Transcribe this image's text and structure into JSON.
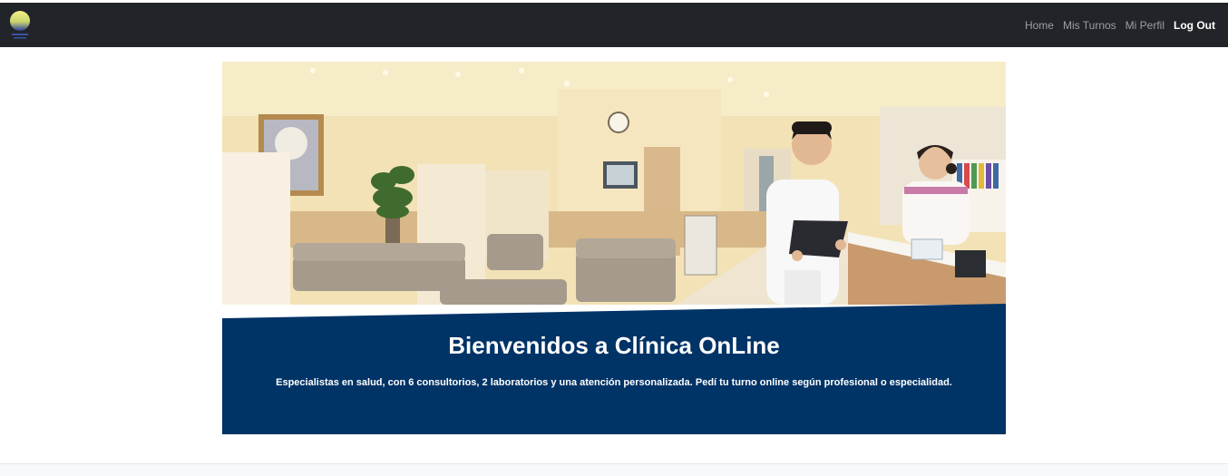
{
  "navbar": {
    "logo_icon": "clinic-logo-sphere",
    "links": [
      {
        "label": "Home"
      },
      {
        "label": "Mis Turnos"
      },
      {
        "label": "Mi Perfil"
      },
      {
        "label": "Log Out"
      }
    ],
    "background": "#212529"
  },
  "hero": {
    "image_alt": "clinic-reception-photo",
    "title": "Bienvenidos a Clínica OnLine",
    "description": "Especialistas en salud, con 6 consultorios, 2 laboratorios y una atención personalizada. Pedí tu turno online según profesional o especialidad.",
    "banner_color": "#003366"
  }
}
